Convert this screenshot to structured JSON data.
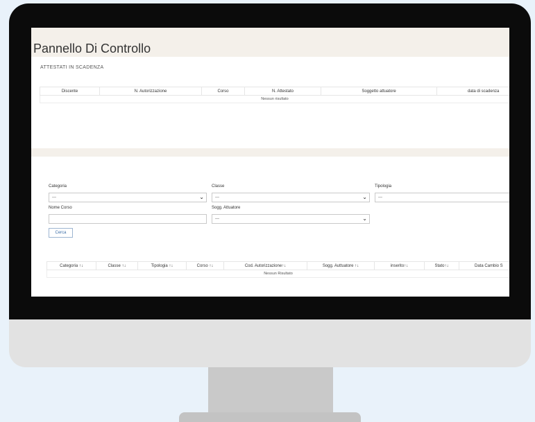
{
  "page": {
    "title": "Pannello Di Controllo"
  },
  "expiring": {
    "heading": "ATTESTATI IN SCADENZA",
    "columns": [
      "Discente",
      "N. Autorizzazione",
      "Corso",
      "N. Attestato",
      "Soggetto attuatore",
      "data di scadenza"
    ],
    "empty_message": "Nessun risultato"
  },
  "filters": {
    "categoria": {
      "label": "Categoria",
      "value": "---"
    },
    "classe": {
      "label": "Classe",
      "value": "---"
    },
    "tipologia": {
      "label": "Tipologia",
      "value": "---"
    },
    "nome_corso": {
      "label": "Nome Corso",
      "value": ""
    },
    "sogg_attuatore": {
      "label": "Sogg. Attuatore",
      "value": "---"
    },
    "search_label": "Cerca"
  },
  "courses": {
    "columns": [
      "Categoria ↑↓",
      "Classe ↑↓",
      "Tipologia ↑↓",
      "Corso ↑↓",
      "Cod. Autorizzazione↑↓",
      "Sogg. Auttuatore ↑↓",
      "inserito↑↓",
      "Stato↑↓",
      "Data Cambio S"
    ],
    "empty_message": "Nessun Risultato"
  }
}
